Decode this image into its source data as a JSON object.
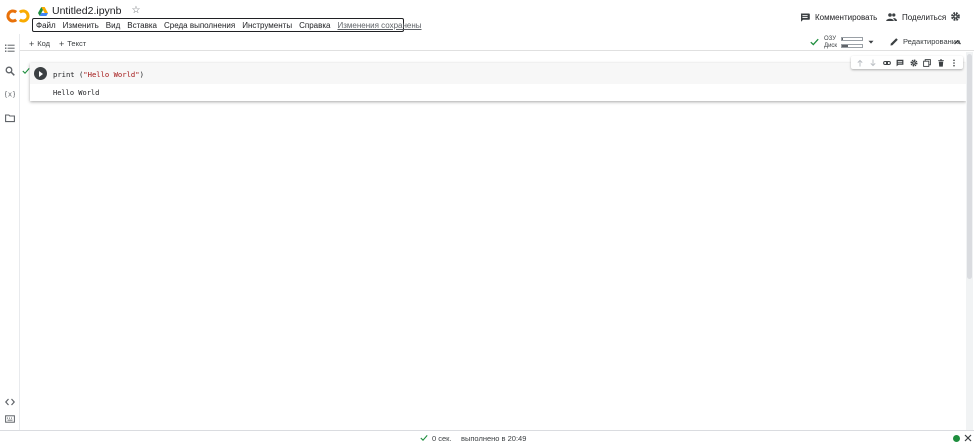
{
  "app": {
    "notebook_title": "Untitled2.ipynb"
  },
  "menu": {
    "items": [
      "Файл",
      "Изменить",
      "Вид",
      "Вставка",
      "Среда выполнения",
      "Инструменты",
      "Справка"
    ],
    "saved_status": "Изменения сохранены"
  },
  "header": {
    "comment_label": "Комментировать",
    "share_label": "Поделиться"
  },
  "toolbar": {
    "add_code_label": "Код",
    "add_text_label": "Текст",
    "ram_label": "ОЗУ",
    "disk_label": "Диск",
    "ram_usage": 0.05,
    "disk_usage": 0.3,
    "edit_mode_label": "Редактирование"
  },
  "cell": {
    "code_prefix": "print (",
    "code_string": "\"Hello World\"",
    "code_suffix": ")",
    "output": "Hello World"
  },
  "statusbar": {
    "duration": "0 сек.",
    "executed_text": "выполнено в 20:49"
  },
  "icons": {
    "logo": "colab-logo",
    "drive": "drive-icon",
    "star": "star-icon",
    "comment": "comment-icon",
    "share": "people-icon",
    "settings": "gear-icon",
    "rail": [
      "toc-icon",
      "search-icon",
      "variables-icon",
      "folder-icon",
      "code-snippets-icon",
      "terminal-icon"
    ]
  },
  "colors": {
    "accent_orange": "#f9ab00",
    "accent_orange_dark": "#e8710a",
    "success_green": "#1e8e3e",
    "string_red": "#a31515"
  }
}
